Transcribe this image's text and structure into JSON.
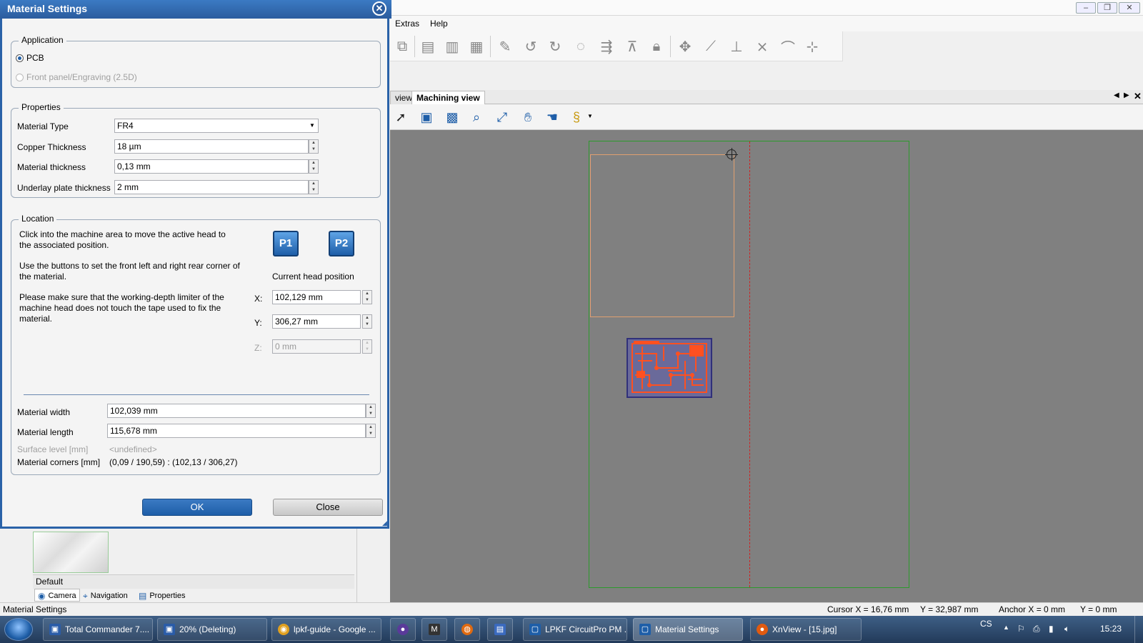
{
  "app": {
    "menu": [
      "Extras",
      "Help"
    ],
    "view_tabs": [
      "view",
      "Machining view"
    ],
    "panel": {
      "default_label": "Default",
      "tabs": [
        "Camera",
        "Navigation",
        "Properties"
      ]
    },
    "status": {
      "left": "Material Settings",
      "cursor_x": "Cursor X =  16,76 mm",
      "cursor_y": "Y =  32,987 mm",
      "anchor_x": "Anchor X =  0 mm",
      "anchor_y": "Y =  0 mm"
    }
  },
  "dialog": {
    "title": "Material Settings",
    "close_glyph": "✕",
    "application": {
      "title": "Application",
      "options": [
        {
          "label": "PCB",
          "checked": true,
          "disabled": false
        },
        {
          "label": "Front panel/Engraving (2.5D)",
          "checked": false,
          "disabled": true
        }
      ]
    },
    "properties": {
      "title": "Properties",
      "material_type": {
        "label": "Material Type",
        "value": "FR4"
      },
      "copper_thickness": {
        "label": "Copper Thickness",
        "value": "18 µm"
      },
      "material_thickness": {
        "label": "Material thickness",
        "value": "0,13 mm"
      },
      "underlay_thickness": {
        "label": "Underlay plate thickness",
        "value": "2 mm"
      }
    },
    "location": {
      "title": "Location",
      "text1": "Click into the machine area to move the active head to the associated position.",
      "text2": "Use the buttons to set the front left and right rear corner of the material.",
      "text3": "Please make sure that the working-depth limiter of the machine head does not touch the tape used to fix the material.",
      "p1": "P1",
      "p2": "P2",
      "head_pos_label": "Current head position",
      "x": {
        "label": "X:",
        "value": "102,129 mm"
      },
      "y": {
        "label": "Y:",
        "value": "306,27 mm"
      },
      "z": {
        "label": "Z:",
        "value": "0 mm"
      },
      "material_width": {
        "label": "Material width",
        "value": "102,039 mm"
      },
      "material_length": {
        "label": "Material length",
        "value": "115,678 mm"
      },
      "surface_level": {
        "label": "Surface level [mm]",
        "value": "<undefined>"
      },
      "material_corners": {
        "label": "Material corners [mm]",
        "value": "(0,09 / 190,59) : (102,13 / 306,27)"
      }
    },
    "ok": "OK",
    "close": "Close"
  },
  "taskbar": {
    "items": [
      {
        "label": "Total Commander 7....",
        "color": "#2a5ca8"
      },
      {
        "label": "20%  (Deleting)",
        "color": "#2a5ca8"
      },
      {
        "label": "lpkf-guide - Google ...",
        "color": "#e0a020"
      },
      {
        "label": "",
        "color": "#5a3a9a"
      },
      {
        "label": "",
        "color": "#333333"
      },
      {
        "label": "",
        "color": "#e06a10"
      },
      {
        "label": "",
        "color": "#3a6abf"
      },
      {
        "label": "LPKF CircuitPro PM ...",
        "color": "#1e5ea8"
      },
      {
        "label": "Material Settings",
        "color": "#1e5ea8"
      },
      {
        "label": "XnView - [15.jpg]",
        "color": "#e05a10"
      }
    ],
    "lang": "CS",
    "clock": "15:23"
  },
  "colors": {
    "accent": "#1e5ea8",
    "canvas": "#808080",
    "machine_border": "#2c9a2c",
    "material_border": "#e0a070",
    "pcb_traces": "#ff5020"
  }
}
